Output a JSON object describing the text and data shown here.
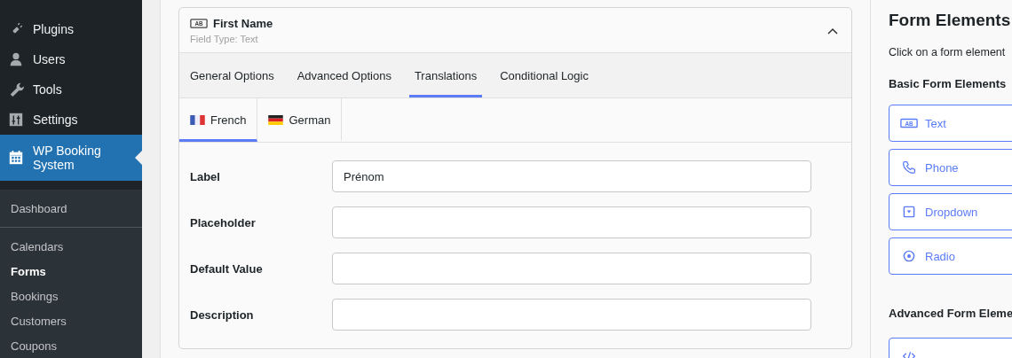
{
  "sidebar": {
    "menu": [
      {
        "label": "Plugins",
        "kind": "plug",
        "selected": false
      },
      {
        "label": "Users",
        "kind": "user",
        "selected": false
      },
      {
        "label": "Tools",
        "kind": "wrench",
        "selected": false
      },
      {
        "label": "Settings",
        "kind": "sliders",
        "selected": false
      },
      {
        "label": "WP Booking System",
        "kind": "calendar",
        "selected": true
      }
    ],
    "submenu_groups": [
      [
        {
          "label": "Dashboard",
          "selected": false
        }
      ],
      [
        {
          "label": "Calendars",
          "selected": false
        },
        {
          "label": "Forms",
          "selected": true
        },
        {
          "label": "Bookings",
          "selected": false
        },
        {
          "label": "Customers",
          "selected": false
        },
        {
          "label": "Coupons",
          "selected": false
        }
      ]
    ]
  },
  "field_card": {
    "icon_text": "AB",
    "title": "First Name",
    "subtitle": "Field Type: Text",
    "expanded": true,
    "tabs": [
      {
        "label": "General Options",
        "selected": false
      },
      {
        "label": "Advanced Options",
        "selected": false
      },
      {
        "label": "Translations",
        "selected": true
      },
      {
        "label": "Conditional Logic",
        "selected": false
      }
    ],
    "languages": [
      {
        "label": "French",
        "kind": "fr",
        "selected": true
      },
      {
        "label": "German",
        "kind": "de",
        "selected": false
      }
    ],
    "fields": [
      {
        "label": "Label",
        "value": "Prénom"
      },
      {
        "label": "Placeholder"
      },
      {
        "label": "Default Value"
      },
      {
        "label": "Description"
      }
    ]
  },
  "form_elements": {
    "title": "Form Elements",
    "hint": "Click on a form element",
    "basic_heading": "Basic Form Elements",
    "basic": [
      {
        "label": "Text",
        "kind": "text",
        "icon_text": "AB"
      },
      {
        "label": "Phone",
        "kind": "phone"
      },
      {
        "label": "Dropdown",
        "kind": "dropdown"
      },
      {
        "label": "Radio",
        "kind": "radio"
      }
    ],
    "advanced_heading": "Advanced Form Eleme",
    "advanced": [
      {
        "kind": "html"
      }
    ]
  }
}
